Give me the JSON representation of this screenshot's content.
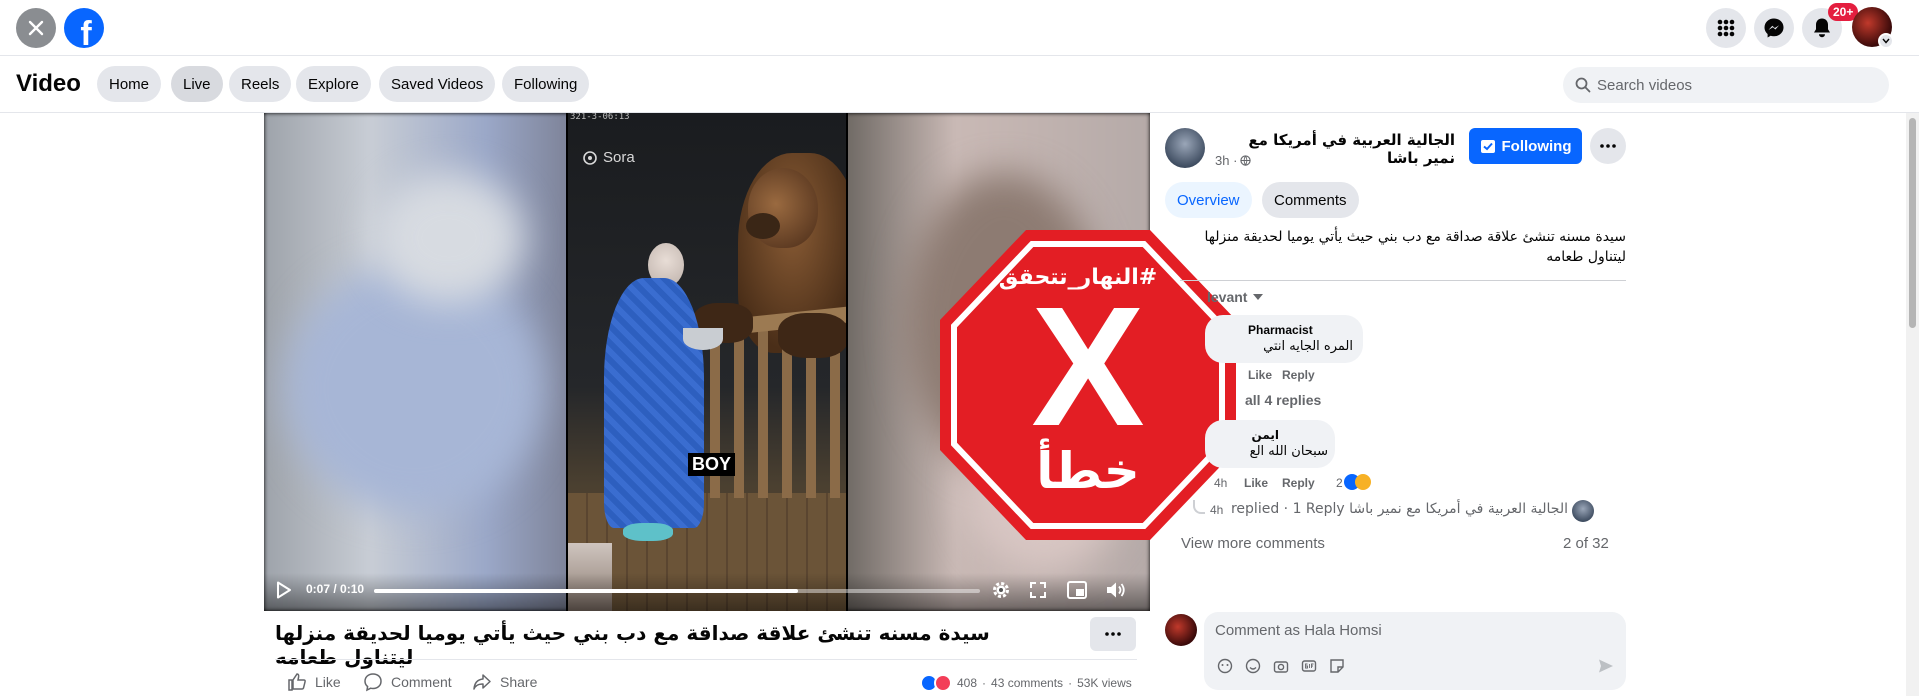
{
  "topbar": {
    "close_icon": "close-icon",
    "logo_letter": "f",
    "notification_badge": "20+",
    "accent": "#0866ff"
  },
  "subnav": {
    "title": "Video",
    "tabs": [
      {
        "label": "Home"
      },
      {
        "label": "Live"
      },
      {
        "label": "Reels"
      },
      {
        "label": "Explore"
      },
      {
        "label": "Saved Videos"
      },
      {
        "label": "Following"
      }
    ],
    "search_placeholder": "Search videos"
  },
  "video": {
    "watermark": "Sora",
    "timestamp_overlay": "321-3-06:13",
    "caption_overlay": "BOY",
    "time": "0:07 / 0:10",
    "progress": 0.7,
    "stamp_hashtag": "#النهار_تتحقق",
    "stamp_letter": "X",
    "stamp_word": "خطأ",
    "stamp_color": "#e31e24"
  },
  "post": {
    "title": "سيدة مسنه تنشئ علاقة صداقة مع دب بني حيث يأتي يوميا لحديقة منزلها ليتناول طعامه",
    "actions": {
      "like": "Like",
      "comment": "Comment",
      "share": "Share"
    },
    "reactions_count": "408",
    "comments_count": "43 comments",
    "views": "53K views",
    "dot_sep": "·"
  },
  "page": {
    "name": "الجالية العربية في أمريكا مع نمير باشا",
    "time": "3h ·",
    "following_label": "Following",
    "tabs": {
      "overview": "Overview",
      "comments": "Comments"
    },
    "description": "سيدة مسنه تنشئ علاقة صداقة مع دب بني حيث يأتي يوميا لحديقة منزلها ليتناول طعامه",
    "sort_label": "levant"
  },
  "comments": [
    {
      "name": "Pharmacist",
      "text": "المره الجايه انتي",
      "like": "Like",
      "reply": "Reply"
    },
    {
      "name": "ايمن",
      "text": "سبحان الله الع",
      "time": "4h",
      "like": "Like",
      "reply": "Reply",
      "reactions": "2"
    }
  ],
  "view_replies": "all 4 replies",
  "reply_summary": {
    "time": "4h",
    "text": "الجالية العربية في أمريكا مع نمير باشا replied · 1 Reply"
  },
  "view_more": "View more comments",
  "pagination": "2 of 32",
  "composer": {
    "placeholder": "Comment as Hala Homsi"
  }
}
